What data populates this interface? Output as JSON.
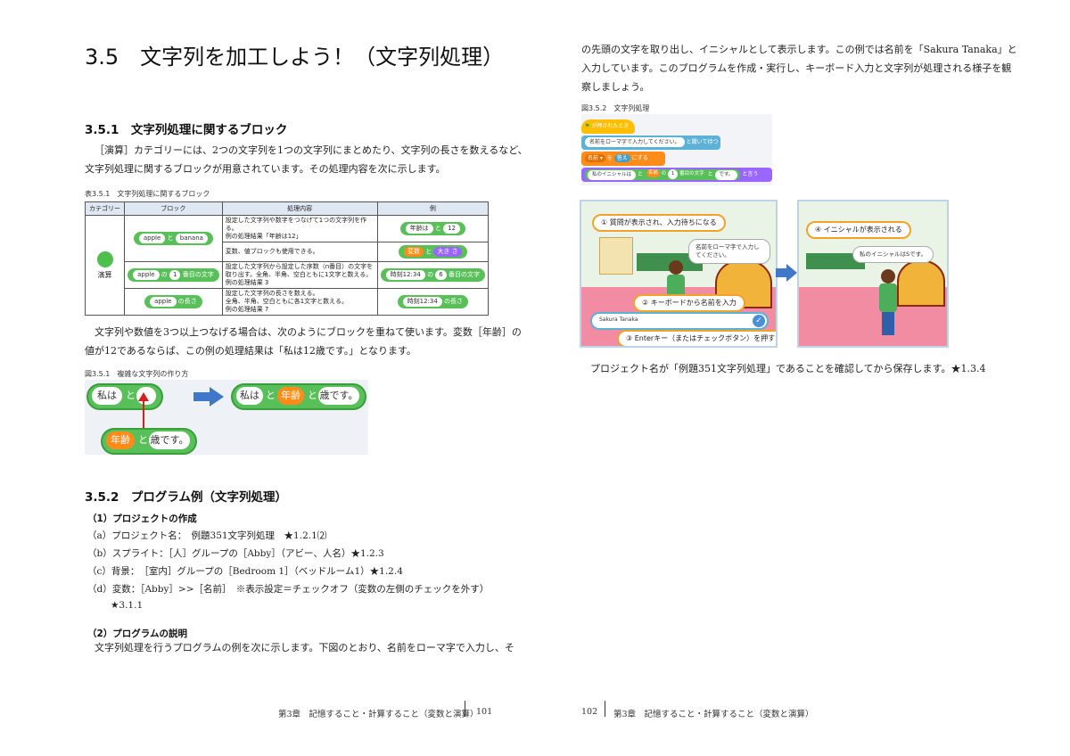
{
  "left_page": {
    "section_title": "3.5　文字列を加工しよう！（文字列処理）",
    "sub1_title": "3.5.1　文字列処理に関するブロック",
    "para1_line1": "［演算］カテゴリーには、2つの文字列を1つの文字列にまとめたり、文字列の長さを数えるなど、",
    "para1_line2": "文字列処理に関するブロックが用意されています。その処理内容を次に示します。",
    "table_caption": "表3.5.1　文字列処理に関するブロック",
    "table": {
      "headers": [
        "カテゴリー",
        "ブロック",
        "処理内容",
        "例"
      ],
      "category_label": "演算",
      "rows": [
        {
          "block": {
            "a": "apple",
            "mid": "と",
            "b": "banana"
          },
          "desc1": "設定した文字列や数字をつなげて1つの文字列を作る。",
          "desc2": "例の処理結果「年齢は12」",
          "ex": {
            "a": "年齢は",
            "mid": "と",
            "b": "12"
          }
        },
        {
          "desc1": "変数、値ブロックも使用できる。",
          "ex": {
            "a": "変数",
            "mid": "と",
            "b": "大き さ"
          }
        },
        {
          "block": {
            "a": "apple",
            "mid": "の",
            "n": "1",
            "tail": "番目の文字"
          },
          "desc1": "設定した文字列から設定した序数（n番目）の文字を",
          "desc2": "取り出す。全角、半角、空白ともに1文字と数える。",
          "desc3": "例の処理結果 3",
          "ex": {
            "a": "時刻12:34",
            "mid": "の",
            "n": "6",
            "tail": "番目の文字"
          }
        },
        {
          "block": {
            "a": "apple",
            "tail": "の長さ"
          },
          "desc1": "設定した文字列の長さを数える。",
          "desc2": "全角、半角、空白ともに各1文字と数える。",
          "desc3": "例の処理結果 7",
          "ex": {
            "a": "時刻12:34",
            "tail": "の長さ"
          }
        }
      ]
    },
    "para2_line1": "文字列や数値を3つ以上つなげる場合は、次のようにブロックを重ねて使います。変数［年齢］の",
    "para2_line2": "値が12であるならば、この例の処理結果は「私は12歳です。」となります。",
    "fig1_caption": "図3.5.1　複雑な文字列の作り方",
    "fig1": {
      "w1": "私は",
      "and": "と",
      "age": "年齢",
      "w2": "歳です。"
    },
    "sub2_title": "3.5.2　プログラム例（文字列処理）",
    "proj_heading": "（1）プロジェクトの作成",
    "proj_items": [
      "（a）プロジェクト名：　例題351文字列処理　★1.2.1⑵",
      "（b）スプライト：［人］グループの［Abby］（アビー、人名）★1.2.3",
      "（c）背景：　［室内］グループの［Bedroom 1］（ベッドルーム1）★1.2.4",
      "（d）変数：［Abby］>>［名前］　※表示設定＝チェックオフ（変数の左側のチェックを外す）"
    ],
    "proj_item_cont": "★3.1.1",
    "expl_heading": "（2）プログラムの説明",
    "expl_line": "文字列処理を行うプログラムの例を次に示します。下図のとおり、名前をローマ字で入力し、そ",
    "footer_text": "第3章　記憶すること・計算すること（変数と演算）",
    "page_number": "101"
  },
  "right_page": {
    "para_line1": "の先頭の文字を取り出し、イニシャルとして表示します。この例では名前を「Sakura Tanaka」と",
    "para_line2": "入力しています。このプログラムを作成・実行し、キーボード入力と文字列が処理される様子を観",
    "para_line3": "察しましょう。",
    "fig2_caption": "図3.5.2　文字列処理",
    "blocks": {
      "hat": "が押されたとき",
      "ask": "名前をローマ字で入力してください。",
      "ask_tail": "と聞いて待つ",
      "set_var": "名前 ▾",
      "set_mid": "を",
      "answer": "答え",
      "set_tail": "にする",
      "say_a": "私のイニシャルは",
      "say_and": "と",
      "say_var": "名前",
      "say_of": "の",
      "say_n": "1",
      "say_nth": "番目の文字",
      "say_and2": "と",
      "say_b": "です。",
      "say_tail": "と言う"
    },
    "screen1": {
      "callout1": "① 質問が表示され、入力待ちになる",
      "bubble": "名前をローマ字で入力してください。",
      "callout2": "② キーボードから名前を入力",
      "input_value": "Sakura Tanaka",
      "callout3": "③ Enterキー（またはチェックボタン）を押す"
    },
    "screen2": {
      "callout4": "④ イニシャルが表示される",
      "bubble": "私のイニシャルはSです。"
    },
    "closing": "プロジェクト名が「例題351文字列処理」であることを確認してから保存します。★1.3.4",
    "page_number": "102",
    "footer_text": "第3章　記憶すること・計算すること（変数と演算）"
  },
  "colors": {
    "operator_green": "#59c059",
    "variable_orange": "#ff8c1a",
    "looks_purple": "#9966ff",
    "sensing_blue": "#5cb1d6",
    "event_yellow": "#ffbf00",
    "arrow_blue": "#3f78c8",
    "callout_border": "#f2a12b"
  }
}
